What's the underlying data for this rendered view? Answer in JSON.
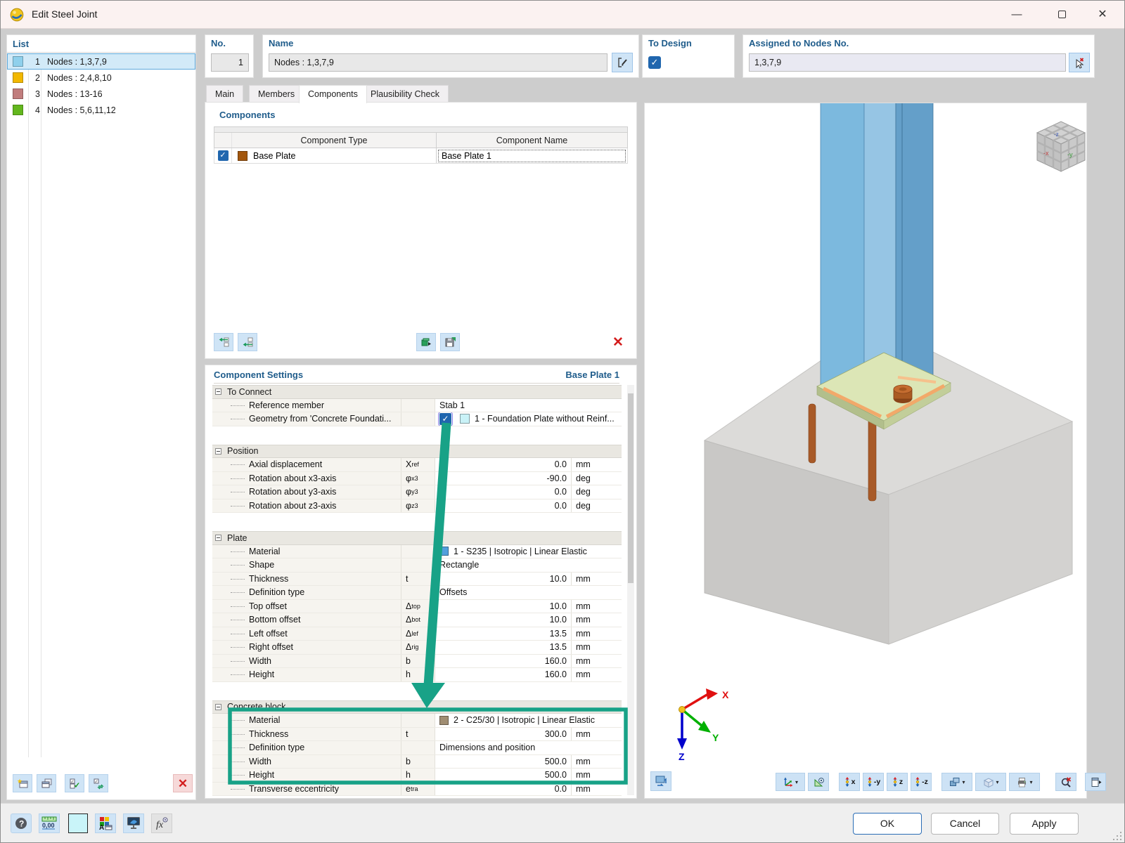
{
  "window": {
    "title": "Edit Steel Joint"
  },
  "icons": {
    "minimize": "—",
    "close": "✕",
    "check": "✓",
    "delete": "✕",
    "dropdown": "▾",
    "help": "?",
    "units": "0,00",
    "fx": "fx"
  },
  "list": {
    "header": "List",
    "items": [
      {
        "num": "1",
        "label": "Nodes : 1,3,7,9",
        "color": "#8fd0ec",
        "selected": true
      },
      {
        "num": "2",
        "label": "Nodes : 2,4,8,10",
        "color": "#f2b800",
        "selected": false
      },
      {
        "num": "3",
        "label": "Nodes : 13-16",
        "color": "#c17d7d",
        "selected": false
      },
      {
        "num": "4",
        "label": "Nodes : 5,6,11,12",
        "color": "#63b71e",
        "selected": false
      }
    ]
  },
  "fields": {
    "no": {
      "label": "No.",
      "value": "1"
    },
    "name": {
      "label": "Name",
      "value": "Nodes : 1,3,7,9"
    },
    "to_design": {
      "label": "To Design",
      "checked": true
    },
    "assigned": {
      "label": "Assigned to Nodes No.",
      "value": "1,3,7,9"
    }
  },
  "tabs": [
    {
      "label": "Main",
      "active": false
    },
    {
      "label": "Members",
      "active": false
    },
    {
      "label": "Components",
      "active": true
    },
    {
      "label": "Plausibility Check",
      "active": false
    }
  ],
  "components": {
    "title": "Components",
    "col_type": "Component Type",
    "col_name": "Component Name",
    "rows": [
      {
        "checked": true,
        "swatch": "#a3570e",
        "type": "Base Plate",
        "name": "Base Plate 1"
      }
    ]
  },
  "settings": {
    "title": "Component Settings",
    "subtitle": "Base Plate 1",
    "sections": [
      {
        "title": "To Connect",
        "rows": [
          {
            "kind": "text",
            "label": "Reference member",
            "value": "Stab 1"
          },
          {
            "kind": "checkbox_swatch",
            "label": "Geometry from 'Concrete Foundati...",
            "checked": true,
            "swatch": "#c9f2f7",
            "value": "1 - Foundation Plate without Reinf..."
          }
        ]
      },
      {
        "title": "Position",
        "rows": [
          {
            "kind": "num",
            "label": "Axial displacement",
            "sym": "X",
            "sub": "ref",
            "value": "0.0",
            "unit": "mm"
          },
          {
            "kind": "num",
            "label": "Rotation about x3-axis",
            "sym": "φ",
            "sub": "x3",
            "value": "-90.0",
            "unit": "deg"
          },
          {
            "kind": "num",
            "label": "Rotation about y3-axis",
            "sym": "φ",
            "sub": "y3",
            "value": "0.0",
            "unit": "deg"
          },
          {
            "kind": "num",
            "label": "Rotation about z3-axis",
            "sym": "φ",
            "sub": "z3",
            "value": "0.0",
            "unit": "deg"
          }
        ]
      },
      {
        "title": "Plate",
        "rows": [
          {
            "kind": "material",
            "label": "Material",
            "swatch": "#529fdc",
            "value": "1 - S235 | Isotropic | Linear Elastic"
          },
          {
            "kind": "text",
            "label": "Shape",
            "value": "Rectangle"
          },
          {
            "kind": "num",
            "label": "Thickness",
            "sym": "t",
            "sub": "",
            "value": "10.0",
            "unit": "mm"
          },
          {
            "kind": "text",
            "label": "Definition type",
            "value": "Offsets"
          },
          {
            "kind": "num",
            "label": "Top offset",
            "sym": "Δ",
            "sub": "top",
            "value": "10.0",
            "unit": "mm"
          },
          {
            "kind": "num",
            "label": "Bottom offset",
            "sym": "Δ",
            "sub": "bot",
            "value": "10.0",
            "unit": "mm"
          },
          {
            "kind": "num",
            "label": "Left offset",
            "sym": "Δ",
            "sub": "lef",
            "value": "13.5",
            "unit": "mm"
          },
          {
            "kind": "num",
            "label": "Right offset",
            "sym": "Δ",
            "sub": "rig",
            "value": "13.5",
            "unit": "mm"
          },
          {
            "kind": "num",
            "label": "Width",
            "sym": "b",
            "sub": "",
            "value": "160.0",
            "unit": "mm"
          },
          {
            "kind": "num",
            "label": "Height",
            "sym": "h",
            "sub": "",
            "value": "160.0",
            "unit": "mm"
          }
        ]
      },
      {
        "title": "Concrete block",
        "rows": [
          {
            "kind": "material",
            "label": "Material",
            "swatch": "#a08d72",
            "value": "2 - C25/30 | Isotropic | Linear Elastic"
          },
          {
            "kind": "num",
            "label": "Thickness",
            "sym": "t",
            "sub": "",
            "value": "300.0",
            "unit": "mm"
          },
          {
            "kind": "text",
            "label": "Definition type",
            "value": "Dimensions and position"
          },
          {
            "kind": "num",
            "label": "Width",
            "sym": "b",
            "sub": "",
            "value": "500.0",
            "unit": "mm"
          },
          {
            "kind": "num",
            "label": "Height",
            "sym": "h",
            "sub": "",
            "value": "500.0",
            "unit": "mm"
          },
          {
            "kind": "num",
            "label": "Transverse eccentricity",
            "sym": "e",
            "sub": "tra",
            "value": "0.0",
            "unit": "mm"
          }
        ]
      }
    ]
  },
  "viewport": {
    "nav_cube": {
      "top": "-z",
      "left": "-x",
      "right": "-y"
    },
    "axes": {
      "x": "X",
      "y": "Y",
      "z": "Z"
    },
    "view_labels": [
      "x",
      "-y",
      "z",
      "-z"
    ]
  },
  "footer": {
    "ok": "OK",
    "cancel": "Cancel",
    "apply": "Apply"
  },
  "annotation": {
    "color": "#18a287"
  }
}
